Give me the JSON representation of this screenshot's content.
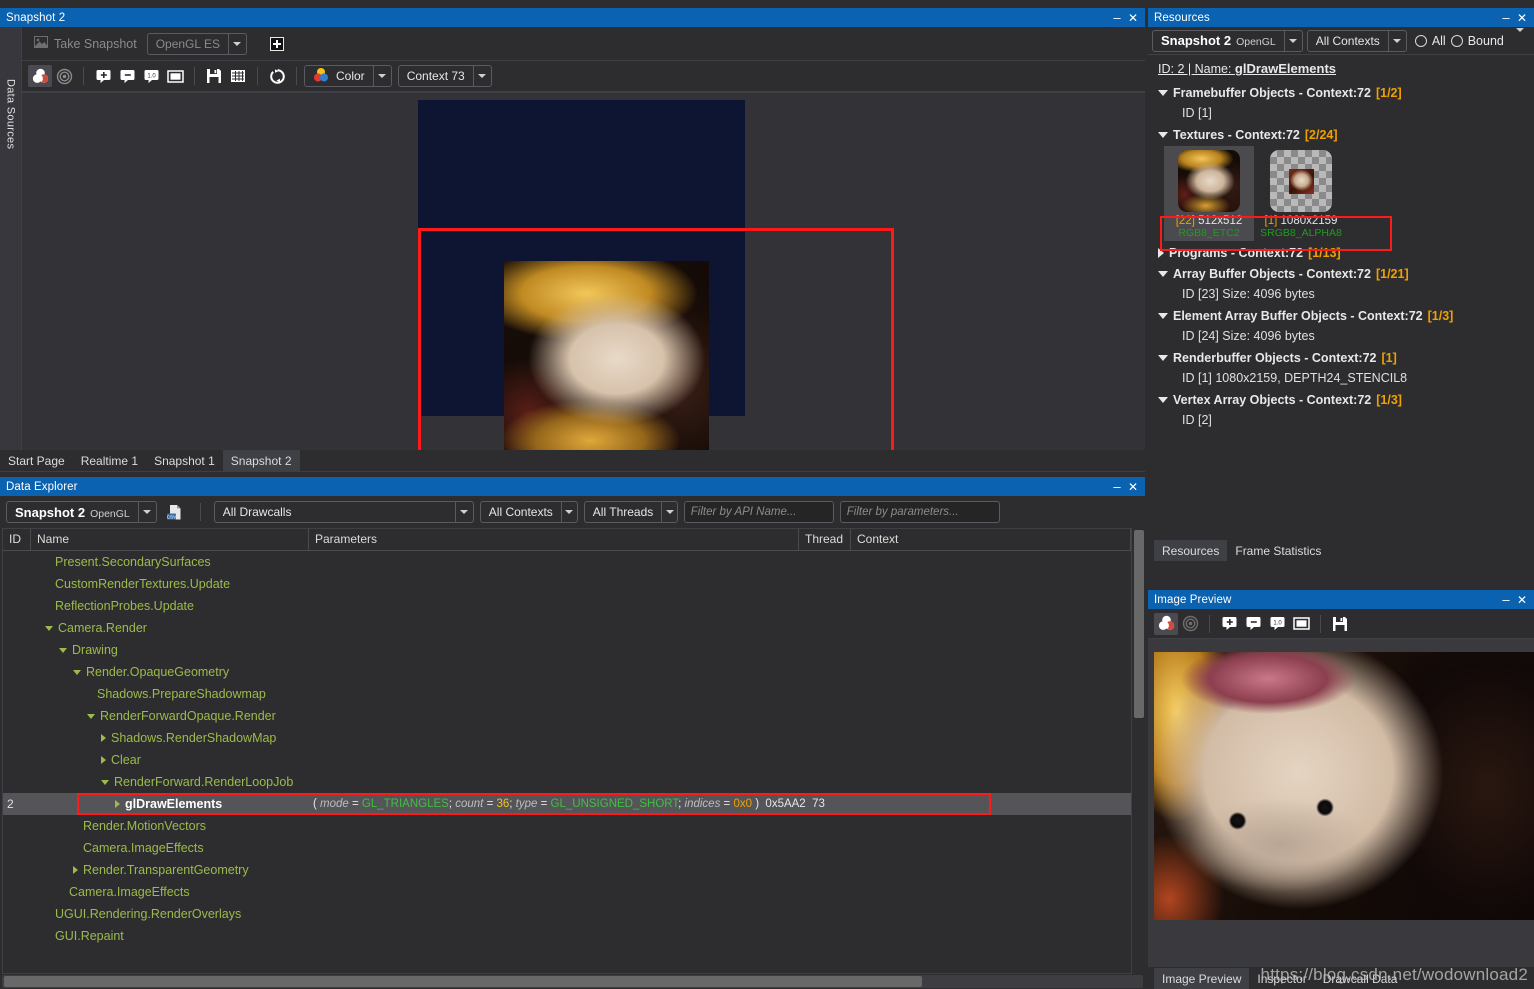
{
  "snapshot_window": {
    "title": "Snapshot 2",
    "take_snapshot_label": "Take Snapshot",
    "api_combo": "OpenGL ES",
    "add_button": "+",
    "side_tab": "Data Sources",
    "view_toolbar": {
      "channel_combo": "Color",
      "context_combo": "Context 73",
      "icons": [
        "color-channels-icon",
        "alpha-icon",
        "zoom-in-icon",
        "zoom-out-icon",
        "zoom-actual-icon",
        "fit-to-window-icon",
        "save-icon",
        "grid-icon",
        "refresh-icon"
      ]
    }
  },
  "document_tabs": [
    {
      "label": "Start Page",
      "selected": false
    },
    {
      "label": "Realtime 1",
      "selected": false
    },
    {
      "label": "Snapshot 1",
      "selected": false
    },
    {
      "label": "Snapshot 2",
      "selected": true
    }
  ],
  "data_explorer": {
    "title": "Data Explorer",
    "snapshot_combo": "Snapshot 2",
    "snapshot_combo_api": "OpenGL",
    "export_icon": "export-csv-icon",
    "drawcalls_filter": "All Drawcalls",
    "contexts_filter": "All Contexts",
    "threads_filter": "All Threads",
    "api_name_placeholder": "Filter by API Name...",
    "parameters_placeholder": "Filter by parameters...",
    "columns": [
      "ID",
      "Name",
      "Parameters",
      "Thread",
      "Context"
    ],
    "rows": [
      {
        "id": "",
        "indent": 1,
        "expander": "none",
        "name": "Present.SecondarySurfaces",
        "selected": false
      },
      {
        "id": "",
        "indent": 1,
        "expander": "none",
        "name": "CustomRenderTextures.Update",
        "selected": false
      },
      {
        "id": "",
        "indent": 1,
        "expander": "none",
        "name": "ReflectionProbes.Update",
        "selected": false
      },
      {
        "id": "",
        "indent": 1,
        "expander": "down",
        "name": "Camera.Render",
        "selected": false
      },
      {
        "id": "",
        "indent": 2,
        "expander": "down",
        "name": "Drawing",
        "selected": false
      },
      {
        "id": "",
        "indent": 3,
        "expander": "down",
        "name": "Render.OpaqueGeometry",
        "selected": false
      },
      {
        "id": "",
        "indent": 4,
        "expander": "none",
        "name": "Shadows.PrepareShadowmap",
        "selected": false
      },
      {
        "id": "",
        "indent": 4,
        "expander": "down",
        "name": "RenderForwardOpaque.Render",
        "selected": false
      },
      {
        "id": "",
        "indent": 5,
        "expander": "right",
        "name": "Shadows.RenderShadowMap",
        "selected": false
      },
      {
        "id": "",
        "indent": 5,
        "expander": "right",
        "name": "Clear",
        "selected": false
      },
      {
        "id": "",
        "indent": 5,
        "expander": "down",
        "name": "RenderForward.RenderLoopJob",
        "selected": false
      },
      {
        "id": "2",
        "indent": 6,
        "expander": "right",
        "name": "glDrawElements",
        "selected": true,
        "params": {
          "open": "( ",
          "items": [
            {
              "key": "mode",
              "eq": " = ",
              "value": "GL_TRIANGLES",
              "kind": "enum",
              "sep": "; "
            },
            {
              "key": "count",
              "eq": " = ",
              "value": "36",
              "kind": "num",
              "sep": "; "
            },
            {
              "key": "type",
              "eq": " = ",
              "value": "GL_UNSIGNED_SHORT",
              "kind": "enum",
              "sep": "; "
            },
            {
              "key": "indices",
              "eq": " = ",
              "value": "0x0",
              "kind": "hex",
              "sep": ""
            }
          ],
          "close": " ) ",
          "thread": "0x5AA2",
          "context": "73"
        }
      },
      {
        "id": "",
        "indent": 3,
        "expander": "none",
        "name": "Render.MotionVectors",
        "selected": false
      },
      {
        "id": "",
        "indent": 3,
        "expander": "none",
        "name": "Camera.ImageEffects",
        "selected": false
      },
      {
        "id": "",
        "indent": 3,
        "expander": "right",
        "name": "Render.TransparentGeometry",
        "selected": false
      },
      {
        "id": "",
        "indent": 2,
        "expander": "none",
        "name": "Camera.ImageEffects",
        "selected": false
      },
      {
        "id": "",
        "indent": 1,
        "expander": "none",
        "name": "UGUI.Rendering.RenderOverlays",
        "selected": false
      },
      {
        "id": "",
        "indent": 1,
        "expander": "none",
        "name": "GUI.Repaint",
        "selected": false
      }
    ]
  },
  "resources": {
    "title": "Resources",
    "snapshot_combo": "Snapshot 2",
    "snapshot_combo_api": "OpenGL",
    "contexts_combo": "All Contexts",
    "radio_all": "All",
    "radio_bound": "Bound",
    "drawcall_line": {
      "prefix": "ID: 2 | Name: ",
      "name": "glDrawElements"
    },
    "groups": [
      {
        "expander": "down",
        "title": "Framebuffer Objects",
        "context": " - Context:72 ",
        "count": "[1/2]",
        "children": [
          "ID [1]"
        ]
      },
      {
        "expander": "down",
        "title": "Textures",
        "context": " - Context:72 ",
        "count": "[2/24]",
        "children": []
      },
      {
        "expander": "right",
        "title": "Programs",
        "context": " - Context:72 ",
        "count": "[1/13]",
        "children": []
      },
      {
        "expander": "down",
        "title": "Array Buffer Objects",
        "context": " - Context:72 ",
        "count": "[1/21]",
        "children": [
          "ID [23] Size: 4096 bytes"
        ]
      },
      {
        "expander": "down",
        "title": "Element Array Buffer Objects",
        "context": " - Context:72 ",
        "count": "[1/3]",
        "children": [
          "ID [24] Size: 4096 bytes"
        ]
      },
      {
        "expander": "down",
        "title": "Renderbuffer Objects",
        "context": " - Context:72 ",
        "count": "[1]",
        "children": [
          "ID [1] 1080x2159, DEPTH24_STENCIL8"
        ]
      },
      {
        "expander": "down",
        "title": "Vertex Array Objects",
        "context": " - Context:72 ",
        "count": "[1/3]",
        "children": [
          "ID [2]"
        ]
      }
    ],
    "textures": [
      {
        "id": "[22]",
        "size": "512x512",
        "format": "RGB8_ETC2",
        "selected": true,
        "thumb": "portrait-texture-thumb"
      },
      {
        "id": "[1]",
        "size": "1080x2159",
        "format": "SRGB8_ALPHA8",
        "selected": false,
        "thumb": "alpha-checker-thumb"
      }
    ],
    "tabs": [
      {
        "label": "Resources",
        "selected": true
      },
      {
        "label": "Frame Statistics",
        "selected": false
      }
    ]
  },
  "image_preview": {
    "title": "Image Preview",
    "icons": [
      "color-channels-icon",
      "alpha-icon",
      "zoom-in-icon",
      "zoom-out-icon",
      "zoom-actual-icon",
      "fit-to-window-icon",
      "save-icon"
    ],
    "tabs": [
      {
        "label": "Image Preview",
        "selected": true
      },
      {
        "label": "Inspector",
        "selected": false
      },
      {
        "label": "Drawcall Data",
        "selected": false
      }
    ]
  },
  "watermark": "https://blog.csdn.net/wodownload2",
  "colors": {
    "titlebar": "#0a62b0",
    "panel": "#2d2d30",
    "tree_text": "#9bbb4a",
    "count_accent": "#f0a000",
    "enum_green": "#3fbf3f",
    "highlight_red": "#ff1a1a"
  }
}
